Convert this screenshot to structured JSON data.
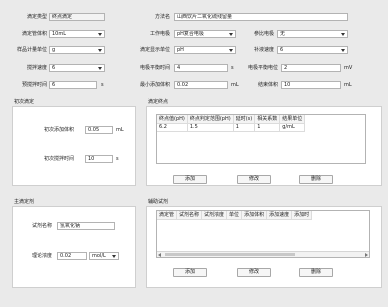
{
  "form": {
    "titration_type_label": "滴定类型",
    "titration_type_value": "终点滴定",
    "method_name_label": "方法名",
    "method_name_value": "山西饮片二氧化硫残留量",
    "burette_volume_label": "滴定管体积",
    "burette_volume_value": "10mL",
    "working_electrode_label": "工作电极",
    "working_electrode_value": "pH复合电极",
    "reference_electrode_label": "参比电极",
    "reference_electrode_value": "无",
    "sample_unit_label": "样品计量单位",
    "sample_unit_value": "g",
    "display_unit_label": "滴定显示单位",
    "display_unit_value": "pH",
    "fill_speed_label": "补液速度",
    "fill_speed_value": "6",
    "stir_speed_label": "搅拌速度",
    "stir_speed_value": "6",
    "balance_time_label": "电极平衡时间",
    "balance_time_value": "4",
    "balance_time_unit": "s",
    "balance_potential_label": "电极平衡电位",
    "balance_potential_value": "2",
    "balance_potential_unit": "mV",
    "pre_stir_label": "预搅拌时间",
    "pre_stir_value": "6",
    "pre_stir_unit": "s",
    "min_add_label": "最小添加体积",
    "min_add_value": "0.02",
    "min_add_unit": "mL",
    "end_volume_label": "结束体积",
    "end_volume_value": "10",
    "end_volume_unit": "mL"
  },
  "initial_titration": {
    "title": "初次滴定",
    "add_volume_label": "初次添加体积",
    "add_volume_value": "0.05",
    "add_volume_unit": "mL",
    "stir_time_label": "初次搅拌时间",
    "stir_time_value": "10",
    "stir_time_unit": "s"
  },
  "endpoint": {
    "title": "滴定终点",
    "columns": [
      "终点值(pH)",
      "终点判定范围(pH)",
      "延时(s)",
      "相关系数",
      "结果单位"
    ],
    "rows": [
      [
        "6.2",
        "1.5",
        "1",
        "1",
        "g/mL"
      ]
    ],
    "add_label": "添加",
    "edit_label": "修改",
    "delete_label": "删除"
  },
  "main_titrant": {
    "title": "主滴定剂",
    "reagent_label": "试剂名称",
    "reagent_value": "氢氧化钠",
    "concentration_label": "理论浓度",
    "concentration_value": "0.02",
    "concentration_unit_value": "mol/L"
  },
  "aux_reagent": {
    "title": "辅助试剂",
    "columns": [
      "滴定管",
      "试剂名称",
      "试剂浓度",
      "单位",
      "添加体积",
      "添加速度",
      "添加时"
    ],
    "add_label": "添加",
    "edit_label": "修改",
    "delete_label": "删除"
  }
}
